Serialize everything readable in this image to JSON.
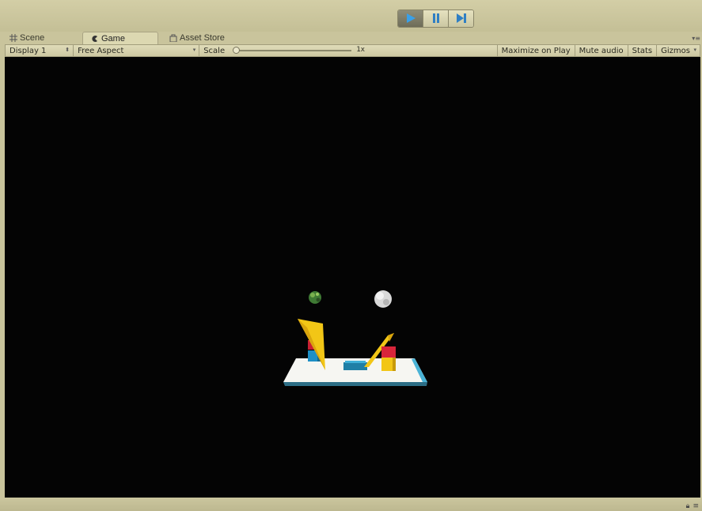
{
  "toolbar": {
    "play_controls": [
      {
        "name": "play",
        "icon": "play-icon",
        "active": true
      },
      {
        "name": "pause",
        "icon": "pause-icon",
        "active": false
      },
      {
        "name": "step",
        "icon": "step-icon",
        "active": false
      }
    ]
  },
  "tabs": [
    {
      "label": "Scene",
      "icon": "grid-icon"
    },
    {
      "label": "Game",
      "icon": "game-controller-icon",
      "selected": true
    },
    {
      "label": "Asset Store",
      "icon": "store-bag-icon"
    }
  ],
  "game_toolbar": {
    "display": "Display 1",
    "aspect": "Free Aspect",
    "scale_label": "Scale",
    "scale_value": "1x",
    "maximize_on_play": "Maximize on Play",
    "mute_audio": "Mute audio",
    "stats": "Stats",
    "gizmos": "Gizmos"
  },
  "colors": {
    "editor_bg": "#c9c49c",
    "viewport_bg": "#040404",
    "play_active": "#3aa0e8",
    "accent_yellow": "#f2c616",
    "accent_red": "#d8253a",
    "accent_blue": "#2a9fd8",
    "platform": "#f4f4f4"
  },
  "status_bar": {
    "icons": [
      "lock-icon",
      "menu-icon"
    ]
  }
}
